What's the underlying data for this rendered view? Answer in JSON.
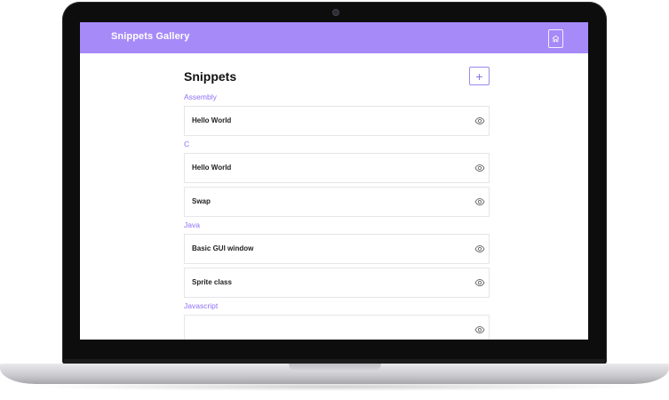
{
  "app": {
    "brand": "Snippets Gallery",
    "home_icon": "home-icon"
  },
  "main": {
    "title": "Snippets",
    "add_label": "+",
    "view_icon": "eye-icon",
    "groups": [
      {
        "category": "Assembly",
        "snippets": [
          "Hello World"
        ]
      },
      {
        "category": "C",
        "snippets": [
          "Hello World",
          "Swap"
        ]
      },
      {
        "category": "Java",
        "snippets": [
          "Basic GUI window",
          "Sprite class"
        ]
      },
      {
        "category": "Javascript",
        "snippets": [
          ""
        ]
      }
    ]
  },
  "colors": {
    "navbar": "#a68af8",
    "accent": "#8f6ff6"
  }
}
